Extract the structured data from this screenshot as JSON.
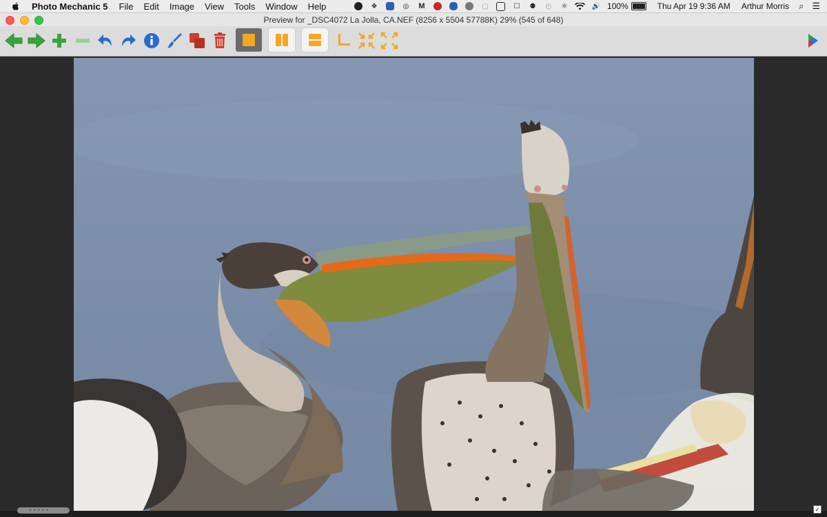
{
  "menubar": {
    "app_name": "Photo Mechanic 5",
    "menus": [
      "File",
      "Edit",
      "Image",
      "View",
      "Tools",
      "Window",
      "Help"
    ],
    "battery": "100%",
    "clock": "Thu Apr 19  9:36 AM",
    "user": "Arthur Morris"
  },
  "window": {
    "title": "Preview for _DSC4072  La  Jolla, CA.NEF (8256 x 5504 57788K) 29% (545 of 648)"
  },
  "toolbar": {
    "buttons": [
      "previous-arrow",
      "next-arrow",
      "zoom-in",
      "zoom-out",
      "rotate-left",
      "rotate-right",
      "info",
      "edit-brush",
      "copy",
      "delete",
      "single-view",
      "side-by-side-view",
      "stacked-view",
      "crop",
      "shrink",
      "expand",
      "app-logo"
    ]
  },
  "colors": {
    "accent_orange": "#f5a623",
    "nav_green": "#3aa43c",
    "rotate_blue": "#2a6bd0",
    "delete_red": "#c8402f"
  }
}
